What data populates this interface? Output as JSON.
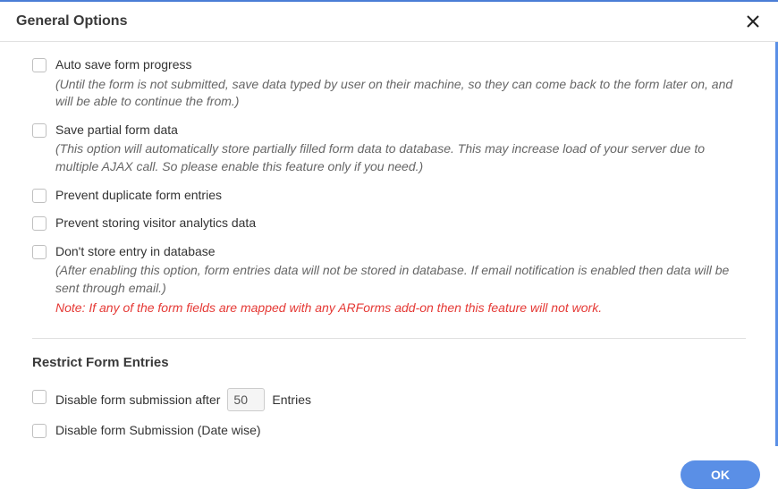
{
  "header": {
    "title": "General Options"
  },
  "options": {
    "autosave": {
      "label": "Auto save form progress",
      "desc": "(Until the form is not submitted, save data typed by user on their machine, so they can come back to the form later on, and will be able to continue the from.)"
    },
    "partial": {
      "label": "Save partial form data",
      "desc": "(This option will automatically store partially filled form data to database. This may increase load of your server due to multiple AJAX call. So please enable this feature only if you need.)"
    },
    "duplicate": {
      "label": "Prevent duplicate form entries"
    },
    "analytics": {
      "label": "Prevent storing visitor analytics data"
    },
    "nostore": {
      "label": "Don't store entry in database",
      "desc": "(After enabling this option, form entries data will not be stored in database. If email notification is enabled then data will be sent through email.)",
      "note": "Note: If any of the form fields are mapped with any ARForms add-on then this feature will not work."
    }
  },
  "restrict": {
    "title": "Restrict Form Entries",
    "disableAfter": {
      "label_pre": "Disable form submission after",
      "value": "50",
      "label_post": "Entries"
    },
    "disableDate": {
      "label": "Disable form Submission (Date wise)"
    }
  },
  "footer": {
    "ok": "OK"
  }
}
